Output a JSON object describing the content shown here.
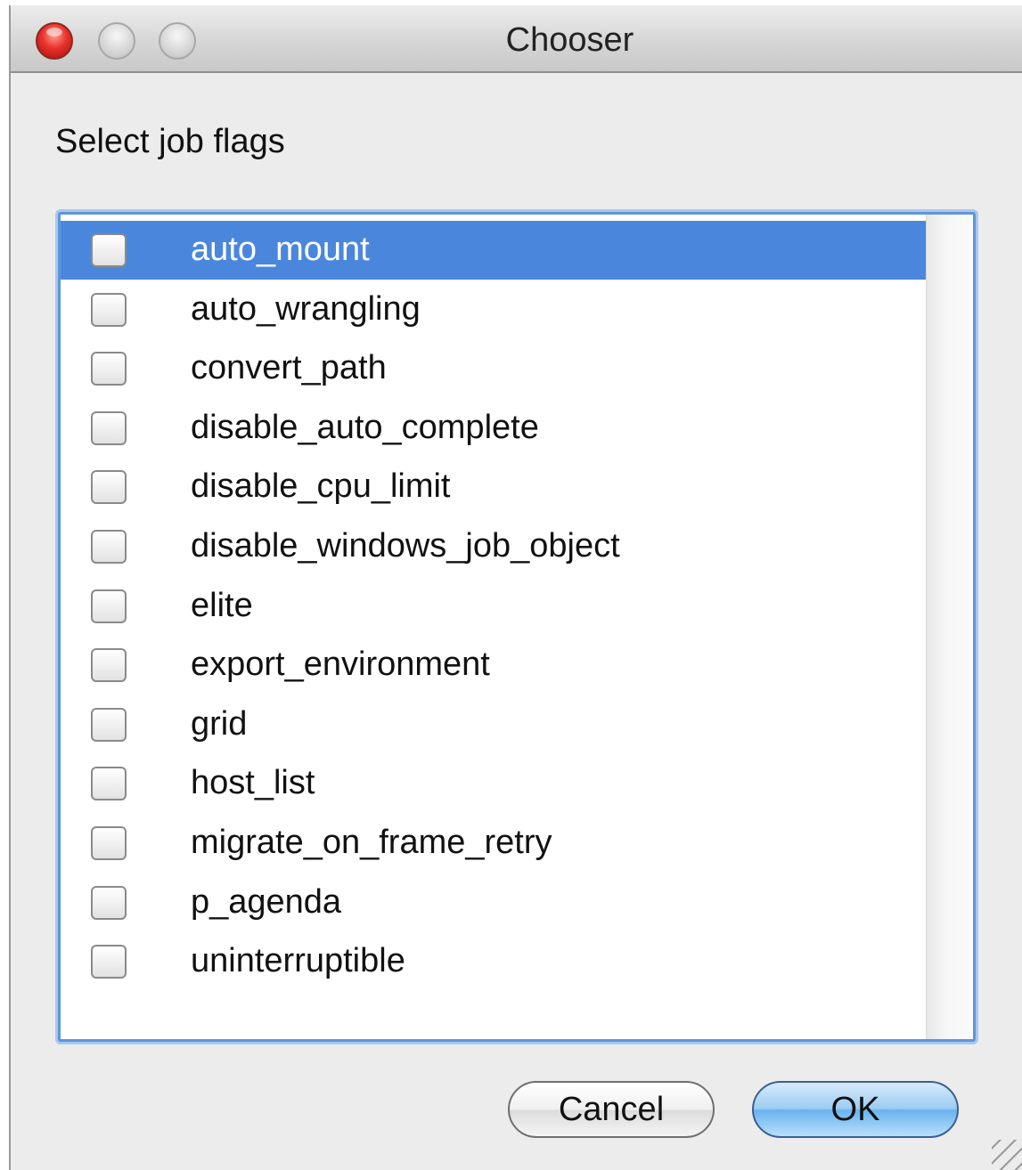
{
  "window": {
    "title": "Chooser"
  },
  "prompt": "Select job flags",
  "flags": [
    {
      "label": "auto_mount",
      "checked": false,
      "selected": true
    },
    {
      "label": "auto_wrangling",
      "checked": false,
      "selected": false
    },
    {
      "label": "convert_path",
      "checked": false,
      "selected": false
    },
    {
      "label": "disable_auto_complete",
      "checked": false,
      "selected": false
    },
    {
      "label": "disable_cpu_limit",
      "checked": false,
      "selected": false
    },
    {
      "label": "disable_windows_job_object",
      "checked": false,
      "selected": false
    },
    {
      "label": "elite",
      "checked": false,
      "selected": false
    },
    {
      "label": "export_environment",
      "checked": false,
      "selected": false
    },
    {
      "label": "grid",
      "checked": false,
      "selected": false
    },
    {
      "label": "host_list",
      "checked": false,
      "selected": false
    },
    {
      "label": "migrate_on_frame_retry",
      "checked": false,
      "selected": false
    },
    {
      "label": "p_agenda",
      "checked": false,
      "selected": false
    },
    {
      "label": "uninterruptible",
      "checked": false,
      "selected": false
    }
  ],
  "buttons": {
    "cancel": "Cancel",
    "ok": "OK"
  },
  "colors": {
    "selection": "#4a87dc",
    "focus_ring": "#5e95d8",
    "close_button": "#e8322b"
  }
}
